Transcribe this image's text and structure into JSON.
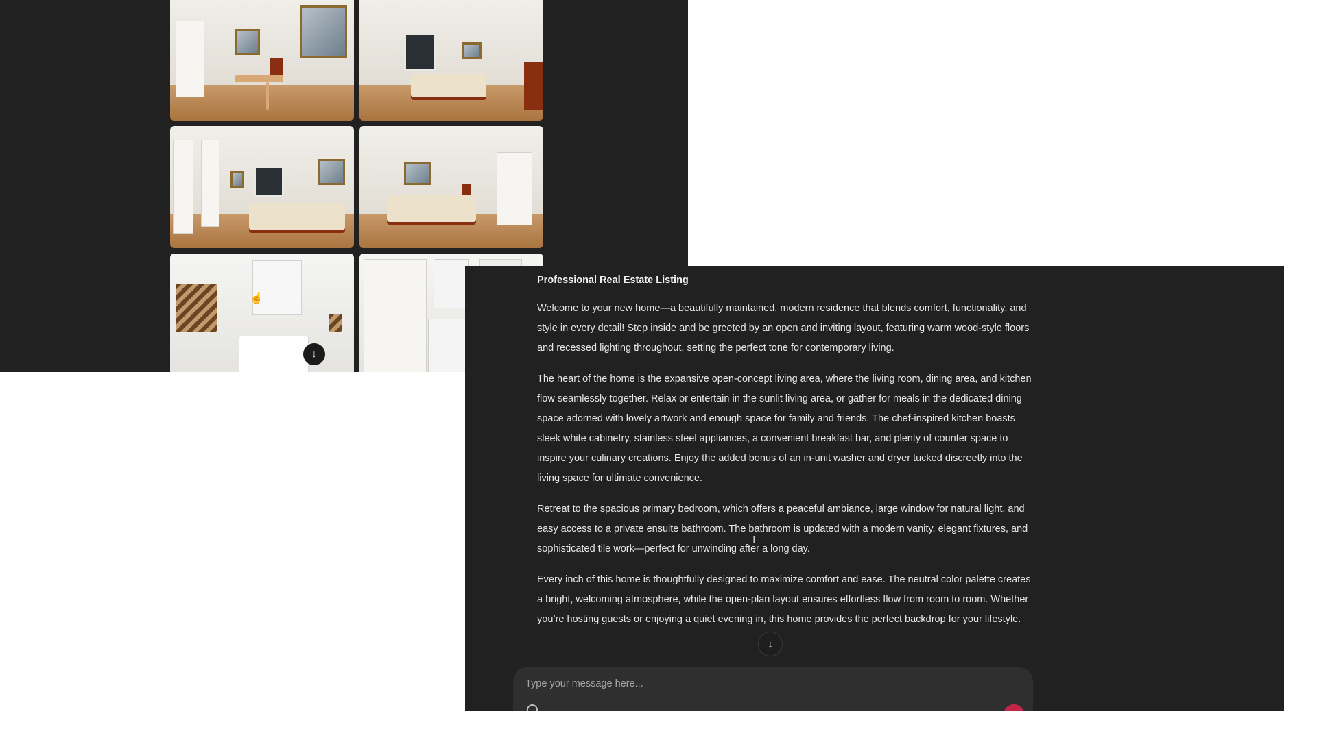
{
  "gallery": {
    "photos": [
      {
        "name": "dining-room"
      },
      {
        "name": "bedroom-window"
      },
      {
        "name": "bedroom-closet"
      },
      {
        "name": "bedroom-ensuite"
      },
      {
        "name": "bathroom-vanity"
      },
      {
        "name": "laundry-closet"
      }
    ],
    "scroll_down_icon": "↓",
    "cursor_icon": "☝"
  },
  "chat": {
    "title": "Professional Real Estate Listing",
    "paragraphs": [
      "Welcome to your new home—a beautifully maintained, modern residence that blends comfort, functionality, and style in every detail! Step inside and be greeted by an open and inviting layout, featuring warm wood-style floors and recessed lighting throughout, setting the perfect tone for contemporary living.",
      "The heart of the home is the expansive open-concept living area, where the living room, dining area, and kitchen flow seamlessly together. Relax or entertain in the sunlit living area, or gather for meals in the dedicated dining space adorned with lovely artwork and enough space for family and friends. The chef-inspired kitchen boasts sleek white cabinetry, stainless steel appliances, a convenient breakfast bar, and plenty of counter space to inspire your culinary creations. Enjoy the added bonus of an in-unit washer and dryer tucked discreetly into the living space for ultimate convenience.",
      "Retreat to the spacious primary bedroom, which offers a peaceful ambiance, large window for natural light, and easy access to a private ensuite bathroom. The bathroom is updated with a modern vanity, elegant fixtures, and sophisticated tile work—perfect for unwinding after a long day.",
      "Every inch of this home is thoughtfully designed to maximize comfort and ease. The neutral color palette creates a bright, welcoming atmosphere, while the open-plan layout ensures effortless flow from room to room. Whether you’re hosting guests or enjoying a quiet evening in, this home provides the perfect backdrop for your lifestyle."
    ],
    "scroll_down_icon": "↓",
    "text_cursor_icon": "I",
    "composer": {
      "placeholder": "Type your message here..."
    },
    "colors": {
      "panel_bg": "#212121",
      "composer_bg": "#2f2f2f",
      "send_accent": "#c2274a"
    }
  }
}
